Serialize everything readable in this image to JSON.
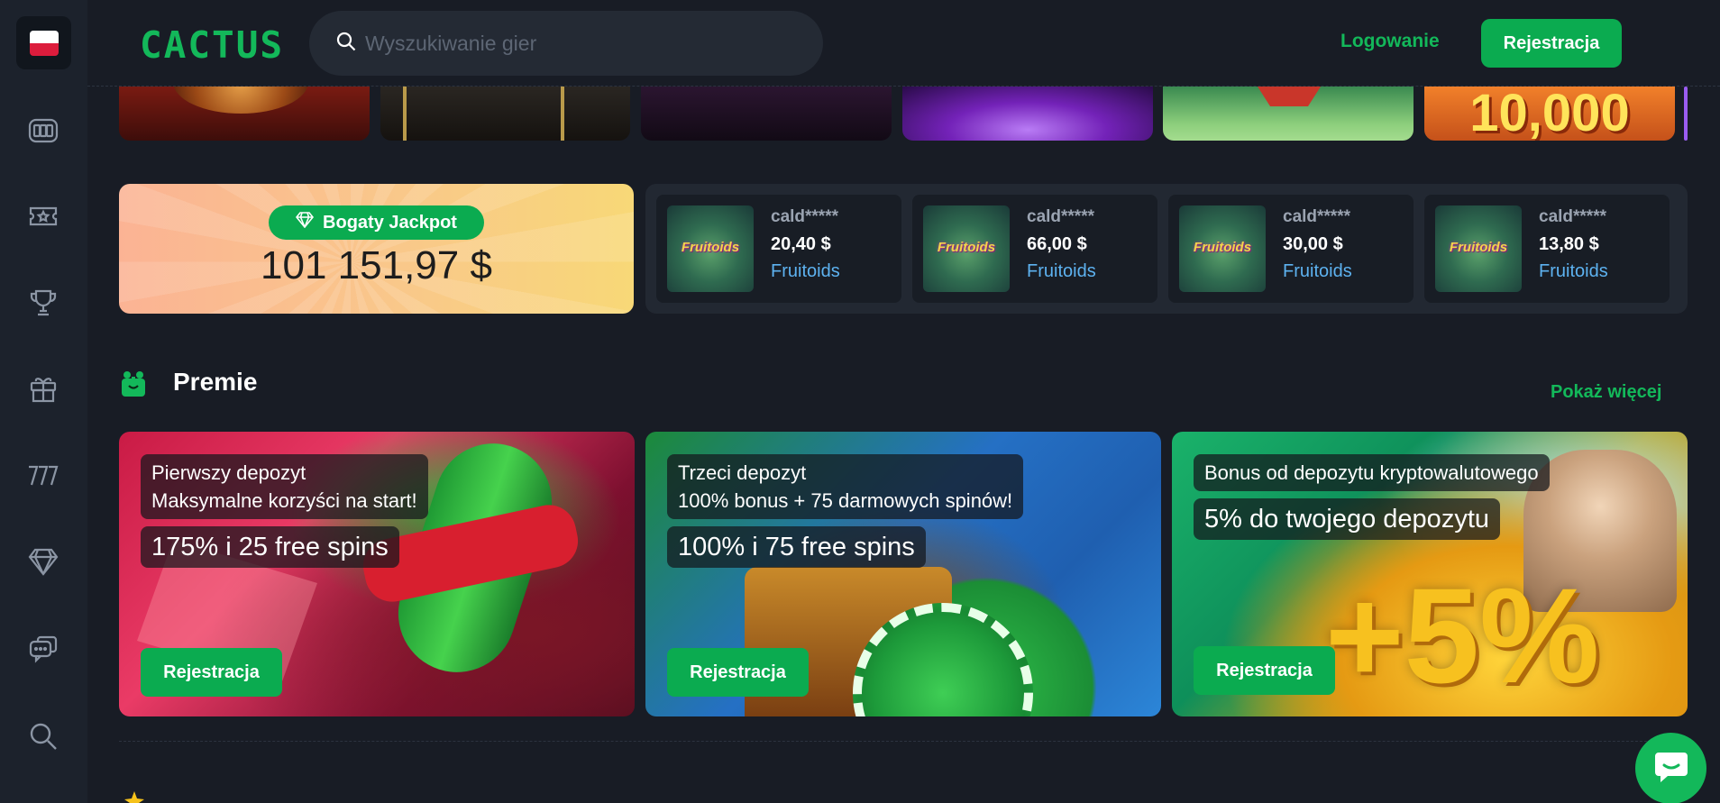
{
  "header": {
    "logo": "CACTUS",
    "search_placeholder": "Wyszukiwanie gier",
    "login_label": "Logowanie",
    "register_label": "Rejestracja"
  },
  "sidebar": {
    "items": [
      {
        "icon": "poland-flag-icon"
      },
      {
        "icon": "slots-icon"
      },
      {
        "icon": "live-casino-ticket-icon"
      },
      {
        "icon": "trophy-icon"
      },
      {
        "icon": "gift-box-icon"
      },
      {
        "icon": "sevens-icon"
      },
      {
        "icon": "diamond-icon"
      },
      {
        "icon": "chat-support-icon"
      },
      {
        "icon": "search-icon"
      }
    ]
  },
  "game_strip": {
    "last_visible_text": "10,000"
  },
  "jackpot": {
    "badge_label": "Bogaty Jackpot",
    "amount": "101 151,97 $"
  },
  "winners": [
    {
      "user": "cald*****",
      "amount": "20,40 $",
      "game": "Fruitoids",
      "thumb_text": "Fruitoids"
    },
    {
      "user": "cald*****",
      "amount": "66,00 $",
      "game": "Fruitoids",
      "thumb_text": "Fruitoids"
    },
    {
      "user": "cald*****",
      "amount": "30,00 $",
      "game": "Fruitoids",
      "thumb_text": "Fruitoids"
    },
    {
      "user": "cald*****",
      "amount": "13,80 $",
      "game": "Fruitoids",
      "thumb_text": "Fruitoids"
    }
  ],
  "premie": {
    "title": "Premie",
    "more_label": "Pokaż więcej",
    "cards": [
      {
        "line1": "Pierwszy depozyt",
        "line2": "Maksymalne korzyści na start!",
        "headline": "175% i 25 free spins",
        "button": "Rejestracja"
      },
      {
        "line1": "Trzeci depozyt",
        "line2": "100% bonus + 75 darmowych spinów!",
        "headline": "100% i 75 free spins",
        "button": "Rejestracja"
      },
      {
        "line1": "Bonus od depozytu kryptowalutowego",
        "line2": "",
        "headline": "5% do twojego depozytu",
        "button": "Rejestracja",
        "art_text": "+5%"
      }
    ]
  },
  "colors": {
    "brand_green": "#0bab50",
    "background": "#181c25",
    "sidebar": "#1c222c",
    "link_blue": "#5db2f0"
  }
}
